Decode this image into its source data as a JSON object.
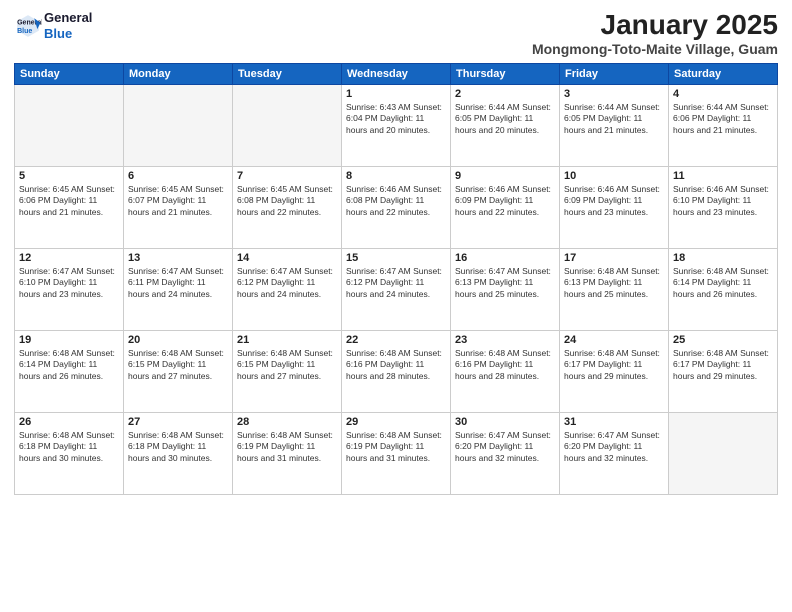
{
  "header": {
    "logo_line1": "General",
    "logo_line2": "Blue",
    "month": "January 2025",
    "location": "Mongmong-Toto-Maite Village, Guam"
  },
  "weekdays": [
    "Sunday",
    "Monday",
    "Tuesday",
    "Wednesday",
    "Thursday",
    "Friday",
    "Saturday"
  ],
  "weeks": [
    [
      {
        "day": "",
        "info": ""
      },
      {
        "day": "",
        "info": ""
      },
      {
        "day": "",
        "info": ""
      },
      {
        "day": "1",
        "info": "Sunrise: 6:43 AM\nSunset: 6:04 PM\nDaylight: 11 hours\nand 20 minutes."
      },
      {
        "day": "2",
        "info": "Sunrise: 6:44 AM\nSunset: 6:05 PM\nDaylight: 11 hours\nand 20 minutes."
      },
      {
        "day": "3",
        "info": "Sunrise: 6:44 AM\nSunset: 6:05 PM\nDaylight: 11 hours\nand 21 minutes."
      },
      {
        "day": "4",
        "info": "Sunrise: 6:44 AM\nSunset: 6:06 PM\nDaylight: 11 hours\nand 21 minutes."
      }
    ],
    [
      {
        "day": "5",
        "info": "Sunrise: 6:45 AM\nSunset: 6:06 PM\nDaylight: 11 hours\nand 21 minutes."
      },
      {
        "day": "6",
        "info": "Sunrise: 6:45 AM\nSunset: 6:07 PM\nDaylight: 11 hours\nand 21 minutes."
      },
      {
        "day": "7",
        "info": "Sunrise: 6:45 AM\nSunset: 6:08 PM\nDaylight: 11 hours\nand 22 minutes."
      },
      {
        "day": "8",
        "info": "Sunrise: 6:46 AM\nSunset: 6:08 PM\nDaylight: 11 hours\nand 22 minutes."
      },
      {
        "day": "9",
        "info": "Sunrise: 6:46 AM\nSunset: 6:09 PM\nDaylight: 11 hours\nand 22 minutes."
      },
      {
        "day": "10",
        "info": "Sunrise: 6:46 AM\nSunset: 6:09 PM\nDaylight: 11 hours\nand 23 minutes."
      },
      {
        "day": "11",
        "info": "Sunrise: 6:46 AM\nSunset: 6:10 PM\nDaylight: 11 hours\nand 23 minutes."
      }
    ],
    [
      {
        "day": "12",
        "info": "Sunrise: 6:47 AM\nSunset: 6:10 PM\nDaylight: 11 hours\nand 23 minutes."
      },
      {
        "day": "13",
        "info": "Sunrise: 6:47 AM\nSunset: 6:11 PM\nDaylight: 11 hours\nand 24 minutes."
      },
      {
        "day": "14",
        "info": "Sunrise: 6:47 AM\nSunset: 6:12 PM\nDaylight: 11 hours\nand 24 minutes."
      },
      {
        "day": "15",
        "info": "Sunrise: 6:47 AM\nSunset: 6:12 PM\nDaylight: 11 hours\nand 24 minutes."
      },
      {
        "day": "16",
        "info": "Sunrise: 6:47 AM\nSunset: 6:13 PM\nDaylight: 11 hours\nand 25 minutes."
      },
      {
        "day": "17",
        "info": "Sunrise: 6:48 AM\nSunset: 6:13 PM\nDaylight: 11 hours\nand 25 minutes."
      },
      {
        "day": "18",
        "info": "Sunrise: 6:48 AM\nSunset: 6:14 PM\nDaylight: 11 hours\nand 26 minutes."
      }
    ],
    [
      {
        "day": "19",
        "info": "Sunrise: 6:48 AM\nSunset: 6:14 PM\nDaylight: 11 hours\nand 26 minutes."
      },
      {
        "day": "20",
        "info": "Sunrise: 6:48 AM\nSunset: 6:15 PM\nDaylight: 11 hours\nand 27 minutes."
      },
      {
        "day": "21",
        "info": "Sunrise: 6:48 AM\nSunset: 6:15 PM\nDaylight: 11 hours\nand 27 minutes."
      },
      {
        "day": "22",
        "info": "Sunrise: 6:48 AM\nSunset: 6:16 PM\nDaylight: 11 hours\nand 28 minutes."
      },
      {
        "day": "23",
        "info": "Sunrise: 6:48 AM\nSunset: 6:16 PM\nDaylight: 11 hours\nand 28 minutes."
      },
      {
        "day": "24",
        "info": "Sunrise: 6:48 AM\nSunset: 6:17 PM\nDaylight: 11 hours\nand 29 minutes."
      },
      {
        "day": "25",
        "info": "Sunrise: 6:48 AM\nSunset: 6:17 PM\nDaylight: 11 hours\nand 29 minutes."
      }
    ],
    [
      {
        "day": "26",
        "info": "Sunrise: 6:48 AM\nSunset: 6:18 PM\nDaylight: 11 hours\nand 30 minutes."
      },
      {
        "day": "27",
        "info": "Sunrise: 6:48 AM\nSunset: 6:18 PM\nDaylight: 11 hours\nand 30 minutes."
      },
      {
        "day": "28",
        "info": "Sunrise: 6:48 AM\nSunset: 6:19 PM\nDaylight: 11 hours\nand 31 minutes."
      },
      {
        "day": "29",
        "info": "Sunrise: 6:48 AM\nSunset: 6:19 PM\nDaylight: 11 hours\nand 31 minutes."
      },
      {
        "day": "30",
        "info": "Sunrise: 6:47 AM\nSunset: 6:20 PM\nDaylight: 11 hours\nand 32 minutes."
      },
      {
        "day": "31",
        "info": "Sunrise: 6:47 AM\nSunset: 6:20 PM\nDaylight: 11 hours\nand 32 minutes."
      },
      {
        "day": "",
        "info": ""
      }
    ]
  ]
}
